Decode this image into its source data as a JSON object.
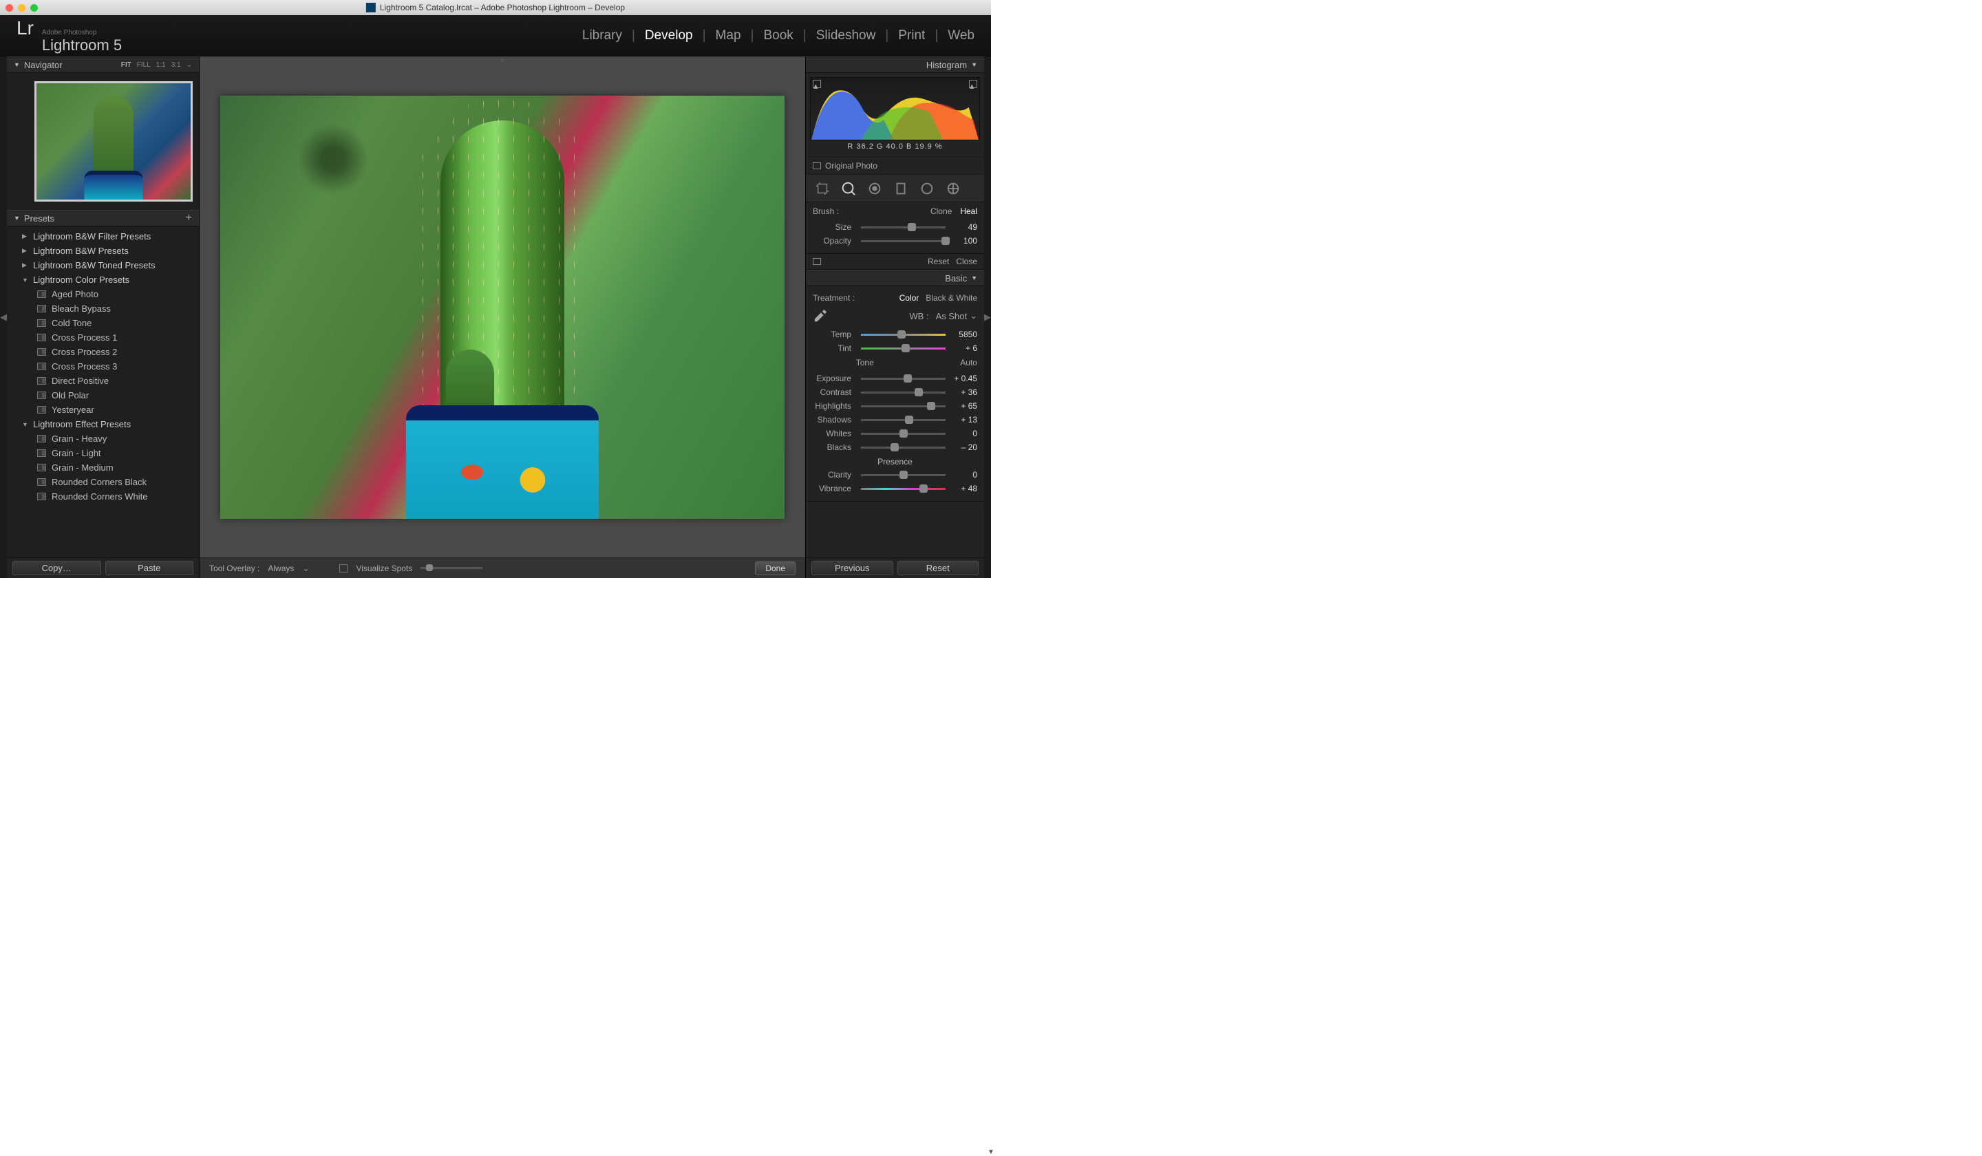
{
  "titlebar": {
    "title": "Lightroom 5 Catalog.lrcat – Adobe Photoshop Lightroom – Develop"
  },
  "header": {
    "brand_small": "Adobe Photoshop",
    "brand": "Lightroom 5",
    "modules": [
      "Library",
      "Develop",
      "Map",
      "Book",
      "Slideshow",
      "Print",
      "Web"
    ],
    "active_module": "Develop"
  },
  "navigator": {
    "title": "Navigator",
    "zoom": [
      "FIT",
      "FILL",
      "1:1",
      "3:1"
    ],
    "zoom_sel": "FIT"
  },
  "presets": {
    "title": "Presets",
    "folders": [
      {
        "name": "Lightroom B&W Filter Presets",
        "open": false
      },
      {
        "name": "Lightroom B&W Presets",
        "open": false
      },
      {
        "name": "Lightroom B&W Toned Presets",
        "open": false
      },
      {
        "name": "Lightroom Color Presets",
        "open": true,
        "items": [
          "Aged Photo",
          "Bleach Bypass",
          "Cold Tone",
          "Cross Process 1",
          "Cross Process 2",
          "Cross Process 3",
          "Direct Positive",
          "Old Polar",
          "Yesteryear"
        ]
      },
      {
        "name": "Lightroom Effect Presets",
        "open": true,
        "items": [
          "Grain - Heavy",
          "Grain - Light",
          "Grain - Medium",
          "Rounded Corners Black",
          "Rounded Corners White"
        ]
      }
    ]
  },
  "left_buttons": {
    "copy": "Copy…",
    "paste": "Paste"
  },
  "center_toolbar": {
    "overlay_label": "Tool Overlay :",
    "overlay_value": "Always",
    "visualize": "Visualize Spots",
    "done": "Done"
  },
  "histogram": {
    "title": "Histogram",
    "readout": "R  36.2   G  40.0   B  19.9 %",
    "original": "Original Photo"
  },
  "tools": [
    "crop",
    "spot",
    "redeye",
    "graduated",
    "radial",
    "brush"
  ],
  "brush": {
    "label": "Brush :",
    "mode_clone": "Clone",
    "mode_heal": "Heal",
    "mode": "Heal",
    "size_label": "Size",
    "size": 49,
    "size_pct": 60,
    "opacity_label": "Opacity",
    "opacity": 100,
    "opacity_pct": 100,
    "reset": "Reset",
    "close": "Close"
  },
  "basic": {
    "title": "Basic",
    "treatment_label": "Treatment :",
    "treatment_color": "Color",
    "treatment_bw": "Black & White",
    "treatment": "Color",
    "wb_label": "WB :",
    "wb_value": "As Shot",
    "temp_label": "Temp",
    "temp": 5850,
    "temp_pct": 48,
    "tint_label": "Tint",
    "tint": "+ 6",
    "tint_pct": 53,
    "tone_label": "Tone",
    "tone_auto": "Auto",
    "exposure_label": "Exposure",
    "exposure": "+ 0.45",
    "exposure_pct": 55,
    "contrast_label": "Contrast",
    "contrast": "+ 36",
    "contrast_pct": 68,
    "highlights_label": "Highlights",
    "highlights": "+ 65",
    "highlights_pct": 83,
    "shadows_label": "Shadows",
    "shadows": "+ 13",
    "shadows_pct": 57,
    "whites_label": "Whites",
    "whites": "0",
    "whites_pct": 50,
    "blacks_label": "Blacks",
    "blacks": "– 20",
    "blacks_pct": 40,
    "presence_label": "Presence",
    "clarity_label": "Clarity",
    "clarity": "0",
    "clarity_pct": 50,
    "vibrance_label": "Vibrance",
    "vibrance": "+ 48",
    "vibrance_pct": 74
  },
  "right_buttons": {
    "previous": "Previous",
    "reset": "Reset"
  }
}
